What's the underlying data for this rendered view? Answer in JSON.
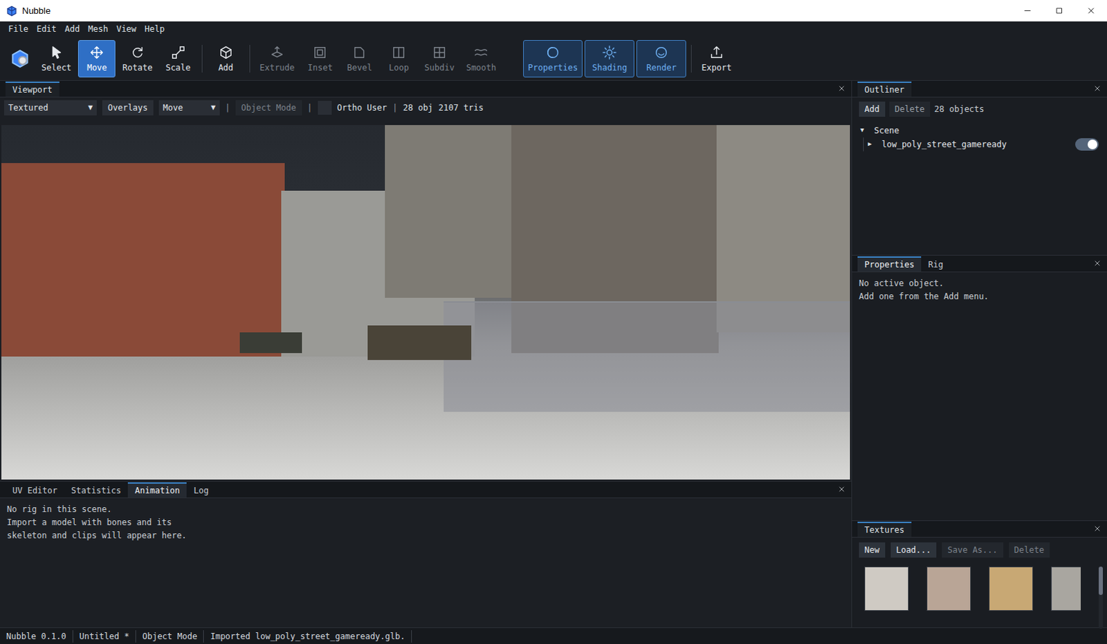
{
  "window": {
    "title": "Nubble"
  },
  "menu": [
    "File",
    "Edit",
    "Add",
    "Mesh",
    "View",
    "Help"
  ],
  "toolbar": [
    {
      "label": "Select",
      "selected": false,
      "on": false,
      "disabled": false
    },
    {
      "label": "Move",
      "selected": true,
      "on": false,
      "disabled": false
    },
    {
      "label": "Rotate",
      "selected": false,
      "on": false,
      "disabled": false
    },
    {
      "label": "Scale",
      "selected": false,
      "on": false,
      "disabled": false
    },
    {
      "label": "Add",
      "selected": false,
      "on": false,
      "disabled": false
    },
    {
      "label": "Extrude",
      "selected": false,
      "on": false,
      "disabled": true
    },
    {
      "label": "Inset",
      "selected": false,
      "on": false,
      "disabled": true
    },
    {
      "label": "Bevel",
      "selected": false,
      "on": false,
      "disabled": true
    },
    {
      "label": "Loop",
      "selected": false,
      "on": false,
      "disabled": true
    },
    {
      "label": "Subdiv",
      "selected": false,
      "on": false,
      "disabled": true
    },
    {
      "label": "Smooth",
      "selected": false,
      "on": false,
      "disabled": true
    },
    {
      "label": "Properties",
      "selected": false,
      "on": true,
      "disabled": false
    },
    {
      "label": "Shading",
      "selected": false,
      "on": true,
      "disabled": false
    },
    {
      "label": "Render",
      "selected": false,
      "on": true,
      "disabled": false
    },
    {
      "label": "Export",
      "selected": false,
      "on": false,
      "disabled": false
    }
  ],
  "viewport": {
    "title": "Viewport",
    "shading": "Textured",
    "shading_arrow": "▼",
    "overlays": "Overlays",
    "transform": "Move",
    "transform_arrow": "▼",
    "separator1": "|",
    "mode": "Object Mode",
    "mode_disabled": true,
    "separator2": "|",
    "snap_checked": false,
    "view": "Ortho User",
    "separator3": "|",
    "objects": "28 obj",
    "tris": "2107 tris"
  },
  "bottom_panel": {
    "tabs": [
      {
        "label": "UV Editor",
        "selected": false
      },
      {
        "label": "Statistics",
        "selected": false
      },
      {
        "label": "Animation",
        "selected": true
      },
      {
        "label": "Log",
        "selected": false
      }
    ],
    "lines": [
      "No rig in this scene.",
      "Import a model with bones and its",
      "skeleton and clips will appear here."
    ]
  },
  "outliner": {
    "title": "Outliner",
    "buttons": [
      "Add",
      "Delete"
    ],
    "count": "28 objects",
    "tree": [
      {
        "label": "Scene",
        "toggle": "▼",
        "expanded": true,
        "has_visibility": false,
        "visible": false
      },
      {
        "label": "low_poly_street_gameready",
        "toggle": "▶",
        "expanded": false,
        "has_visibility": true,
        "visible": true
      }
    ]
  },
  "properties": {
    "tabs": [
      {
        "label": "Properties",
        "selected": true
      },
      {
        "label": "Rig",
        "selected": false
      }
    ],
    "lines": [
      "No active object.",
      "Add one from the Add menu."
    ]
  },
  "textures": {
    "title": "Textures",
    "buttons": [
      {
        "label": "New",
        "disabled": false
      },
      {
        "label": "Load...",
        "disabled": false
      },
      {
        "label": "Save As...",
        "disabled": true
      },
      {
        "label": "Delete",
        "disabled": true
      }
    ],
    "thumbnails": [
      {
        "color": "#cfcac3"
      },
      {
        "color": "#b9a596"
      },
      {
        "color": "#c8a874"
      },
      {
        "color": "#a9a6a0"
      }
    ],
    "scroll_level": 0.45
  },
  "status_bar": [
    "Nubble 0.1.0",
    "Untitled *",
    "Object Mode",
    "Imported low_poly_street_gameready.glb."
  ]
}
